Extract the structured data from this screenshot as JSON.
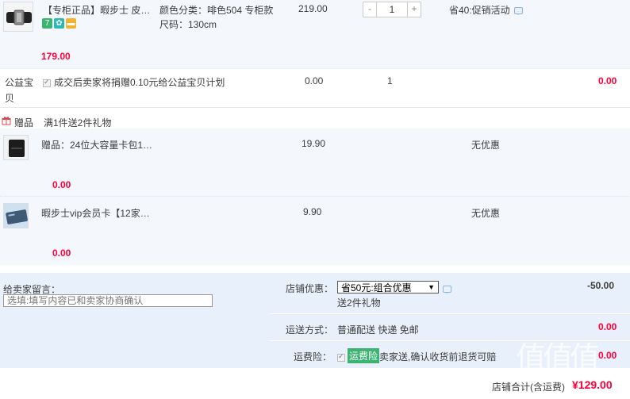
{
  "main_item": {
    "title": "【专柜正品】暇步士 皮…",
    "spec_color": "颜色分类：啡色504 专柜款",
    "spec_size": "尺码：130cm",
    "unit_price": "219.00",
    "qty_minus": "-",
    "qty_value": "1",
    "qty_plus": "+",
    "promo": "省40:促销活动",
    "subtotal": "179.00",
    "colors": {
      "badge_green": "#3cb371",
      "badge_teal": "#2bbab3",
      "badge_yellow": "#f3b32a"
    }
  },
  "charity": {
    "label": "公益宝贝",
    "text": "成交后卖家将捐赠0.10元给公益宝贝计划",
    "price": "0.00",
    "qty": "1",
    "total": "0.00"
  },
  "gifts": {
    "header_label": "赠品",
    "header_text": "满1件送2件礼物",
    "items": [
      {
        "title": "赠品：24位大容量卡包1…",
        "price": "19.90",
        "discount": "无优惠",
        "subtotal": "0.00"
      },
      {
        "title": "暇步士vip会员卡【12家…",
        "price": "9.90",
        "discount": "无优惠",
        "subtotal": "0.00"
      }
    ]
  },
  "footer": {
    "message_label": "给卖家留言：",
    "message_placeholder": "选填:填写内容已和卖家协商确认",
    "shop_discount_label": "店铺优惠：",
    "shop_discount_selected": "省50元:组合优惠",
    "shop_discount_value": "-50.00",
    "gift_note": "送2件礼物",
    "shipping_label": "运送方式：",
    "shipping_value": "普通配送 快递 免邮",
    "shipping_cost": "0.00",
    "insurance_label": "运费险：",
    "insurance_tag": "运费险",
    "insurance_text": "卖家送,确认收货前退货可赔",
    "insurance_cost": "0.00",
    "total_label": "店铺合计(含运费)",
    "total_value": "¥129.00"
  },
  "watermark": "值值值",
  "colors": {
    "accent_red": "#ff0036",
    "panel_bg": "#e8f1fb"
  }
}
